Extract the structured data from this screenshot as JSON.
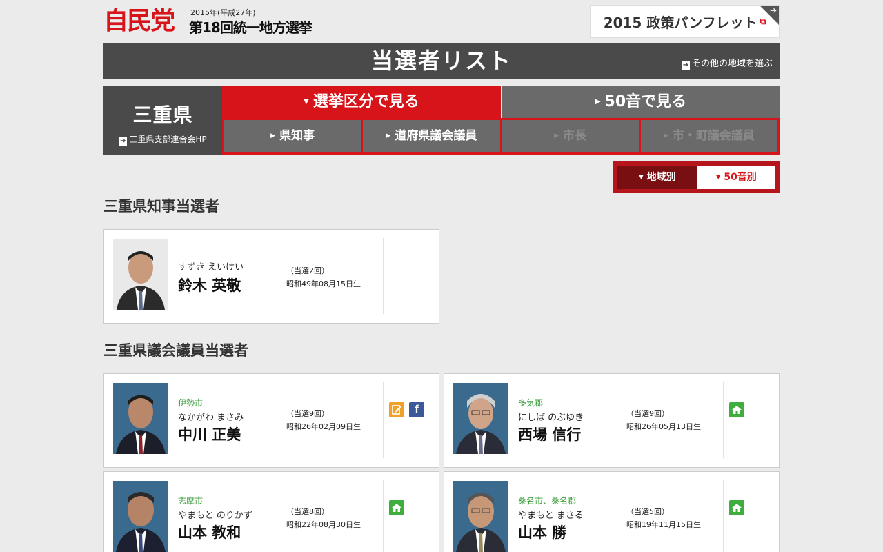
{
  "header": {
    "logo": "自民党",
    "year": "2015年(平成27年)",
    "election": "第18回統一地方選挙",
    "pamphlet": "2015 政策パンフレット"
  },
  "titlebar": {
    "title": "当選者リスト",
    "other_region": "その他の地域を選ぶ"
  },
  "nav": {
    "prefecture": "三重県",
    "prefecture_hp": "三重県支部連合会HP",
    "tab_category": "選挙区分で見る",
    "tab_kana": "50音で見る",
    "sub": [
      "県知事",
      "道府県議会議員",
      "市長",
      "市・町議会議員"
    ]
  },
  "sort": {
    "by_region": "地域別",
    "by_kana": "50音別"
  },
  "sections": {
    "governor": "三重県知事当選者",
    "assembly": "三重県議会議員当選者"
  },
  "governor": {
    "kana": "すずき えいけい",
    "name": "鈴木 英敬",
    "times": "（当選2回）",
    "born": "昭和49年08月15日生"
  },
  "members": [
    {
      "region": "伊勢市",
      "kana": "なかがわ まさみ",
      "name": "中川 正美",
      "times": "（当選9回）",
      "born": "昭和26年02月09日生",
      "icons": [
        "blog-icon",
        "facebook-icon"
      ]
    },
    {
      "region": "多気郡",
      "kana": "にしば のぶゆき",
      "name": "西場 信行",
      "times": "（当選9回）",
      "born": "昭和26年05月13日生",
      "icons": [
        "home-icon"
      ]
    },
    {
      "region": "志摩市",
      "kana": "やまもと のりかず",
      "name": "山本 教和",
      "times": "（当選8回）",
      "born": "昭和22年08月30日生",
      "icons": [
        "home-icon"
      ]
    },
    {
      "region": "桑名市、桑名郡",
      "kana": "やまもと まさる",
      "name": "山本 勝",
      "times": "（当選5回）",
      "born": "昭和19年11月15日生",
      "icons": [
        "home-icon"
      ]
    }
  ],
  "colors": {
    "brand_red": "#d7141a",
    "dark_gray": "#4a4a4a",
    "region_green": "#3a9e3a"
  }
}
